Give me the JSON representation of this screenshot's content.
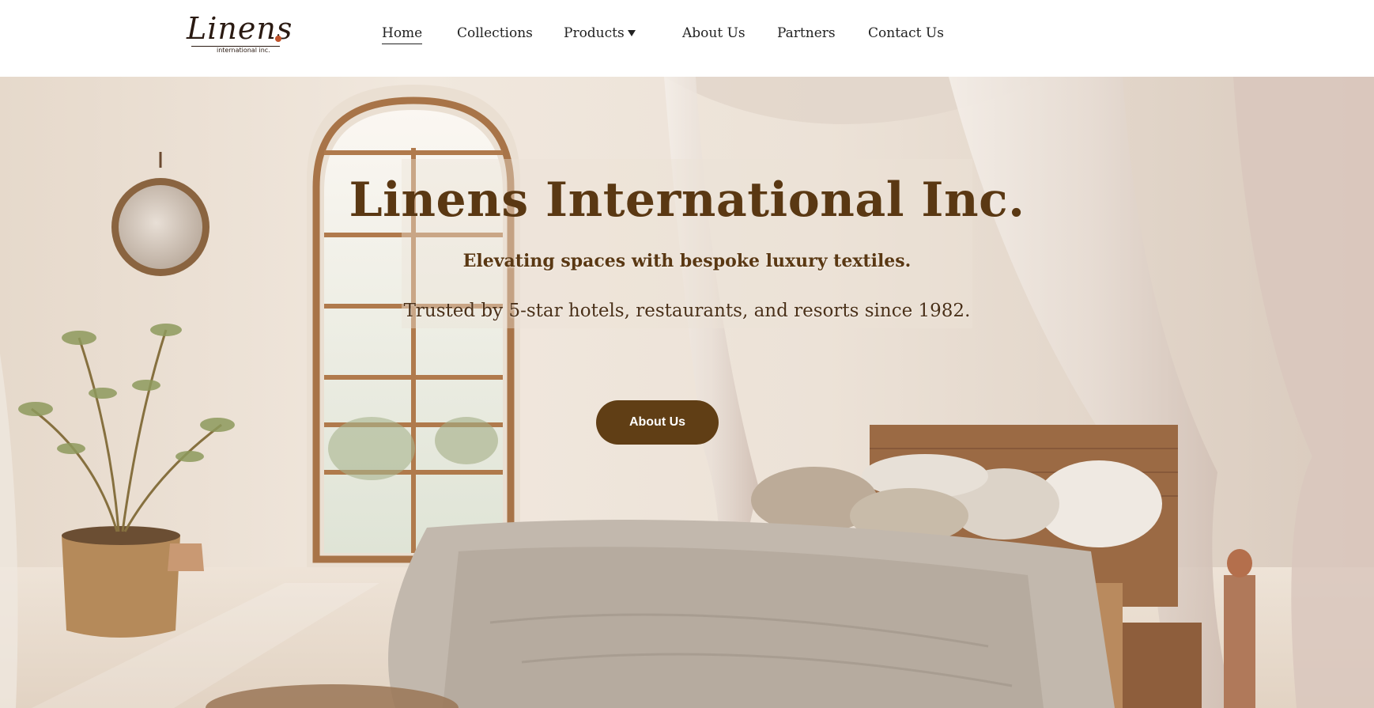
{
  "header": {
    "logo": {
      "word": "Linens",
      "subtitle": "international inc."
    },
    "nav": {
      "home": "Home",
      "collections": "Collections",
      "products": "Products",
      "about": "About Us",
      "partners": "Partners",
      "contact": "Contact Us"
    },
    "active_item": "Home"
  },
  "hero": {
    "title": "Linens International Inc.",
    "tagline": "Elevating spaces with bespoke luxury textiles.",
    "trust": "Trusted by 5-star hotels, restaurants, and resorts since 1982.",
    "button_label": "About Us",
    "background_scene": "bedroom-with-canopy-bed",
    "colors": {
      "brand_brown": "#603e15",
      "title_brown": "#5a3813",
      "logo_dot": "#c0522a"
    }
  }
}
